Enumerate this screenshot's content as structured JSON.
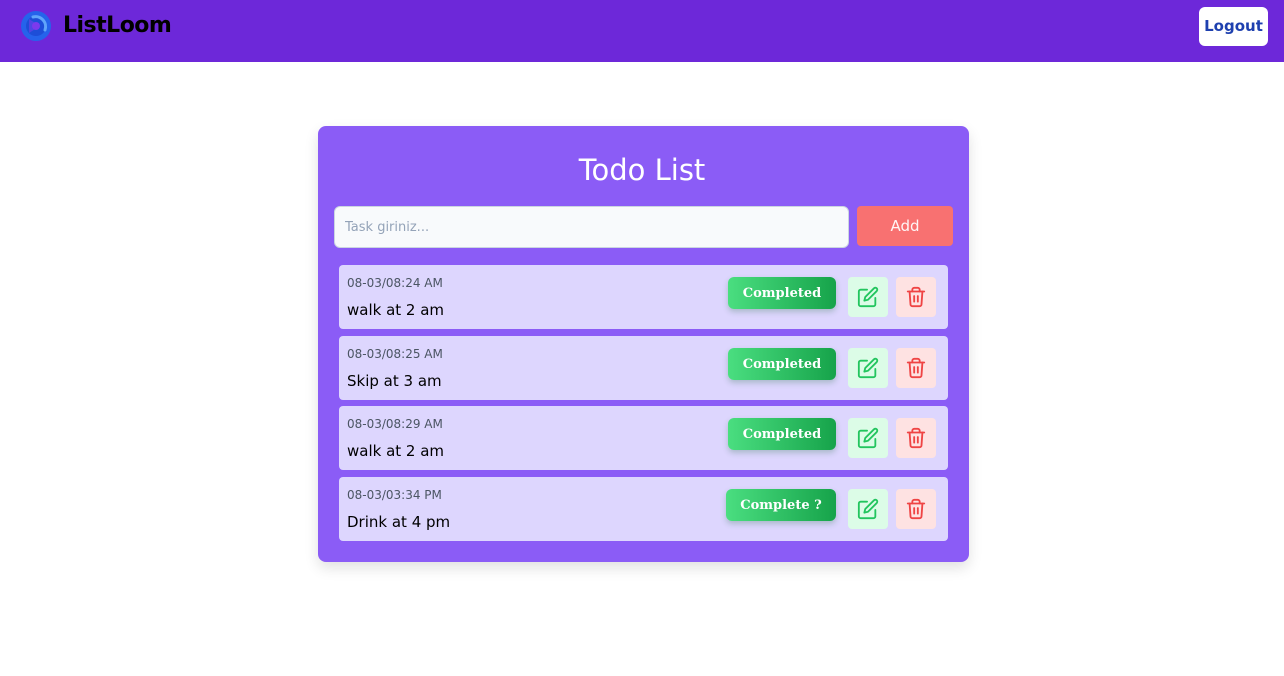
{
  "header": {
    "brand_name": "ListLoom",
    "logout_label": "Logout"
  },
  "main": {
    "title": "Todo List",
    "input_placeholder": "Task giriniz...",
    "add_label": "Add"
  },
  "todos": [
    {
      "date": "08-03/08:24 AM",
      "text": "walk at 2 am",
      "status": "Completed"
    },
    {
      "date": "08-03/08:25 AM",
      "text": "Skip at 3 am",
      "status": "Completed"
    },
    {
      "date": "08-03/08:29 AM",
      "text": "walk at 2 am",
      "status": "Completed"
    },
    {
      "date": "08-03/03:34 PM",
      "text": "Drink at 4 pm",
      "status": "Complete ?"
    }
  ],
  "colors": {
    "navbar": "#6d28d9",
    "card": "#8b5cf6",
    "item": "#ddd6fe",
    "add_button": "#f87171",
    "status_green": "#16a34a",
    "edit_icon": "#22c55e",
    "delete_icon": "#ef4444",
    "logout_text": "#1e40af"
  },
  "icons": {
    "brand": "listloom-logo-icon",
    "edit": "edit-pencil-icon",
    "delete": "trash-icon"
  }
}
